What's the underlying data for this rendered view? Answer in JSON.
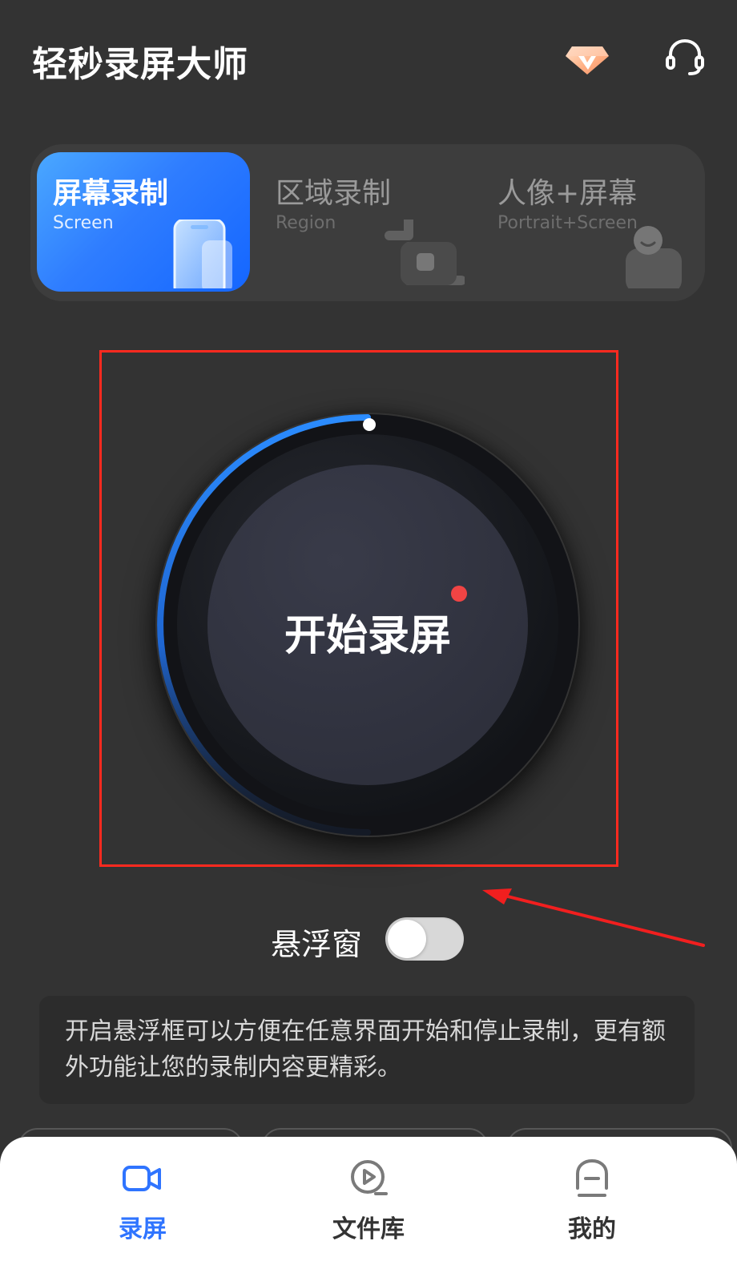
{
  "header": {
    "title": "轻秒录屏大师",
    "icons": {
      "vip": "diamond-vip-icon",
      "support": "headset-icon"
    }
  },
  "modes": [
    {
      "title": "屏幕录制",
      "subtitle": "Screen",
      "icon": "phone-icon",
      "selected": true
    },
    {
      "title": "区域录制",
      "subtitle": "Region",
      "icon": "region-crop-icon",
      "selected": false
    },
    {
      "title": "人像+屏幕",
      "subtitle": "Portrait+Screen",
      "icon": "portrait-icon",
      "selected": false
    }
  ],
  "record": {
    "label": "开始录屏",
    "status_dot": "red-dot-icon"
  },
  "floating_window": {
    "label": "悬浮窗",
    "enabled": false
  },
  "info": {
    "text": "开启悬浮框可以方便在任意界面开始和停止录制，更有额外功能让您的录制内容更精彩。"
  },
  "bottom_nav": {
    "items": [
      {
        "label": "录屏",
        "icon": "video-camera-icon",
        "active": true
      },
      {
        "label": "文件库",
        "icon": "play-library-icon",
        "active": false
      },
      {
        "label": "我的",
        "icon": "profile-icon",
        "active": false
      }
    ]
  },
  "colors": {
    "background": "#333333",
    "accent_blue": "#2f74ff",
    "highlight_red": "#ff2a1f",
    "toggle_off": "#d8d8d8"
  }
}
